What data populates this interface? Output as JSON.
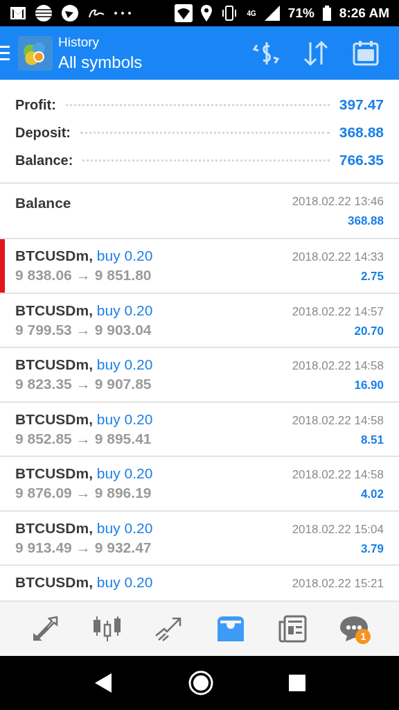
{
  "status_bar": {
    "network": "4G",
    "battery": "71%",
    "time": "8:26 AM"
  },
  "app_bar": {
    "title": "History",
    "subtitle": "All symbols"
  },
  "summary": [
    {
      "label": "Profit:",
      "value": "397.47"
    },
    {
      "label": "Deposit:",
      "value": "368.88"
    },
    {
      "label": "Balance:",
      "value": "766.35"
    }
  ],
  "entries": [
    {
      "kind": "balance",
      "selected": false,
      "title": "Balance",
      "time": "2018.02.22 13:46",
      "amount": "368.88"
    },
    {
      "kind": "trade",
      "selected": true,
      "symbol": "BTCUSDm,",
      "side": "buy 0.20",
      "open": "9 838.06",
      "arrow": "→",
      "close": "9 851.80",
      "time": "2018.02.22 14:33",
      "amount": "2.75"
    },
    {
      "kind": "trade",
      "selected": false,
      "symbol": "BTCUSDm,",
      "side": "buy 0.20",
      "open": "9 799.53",
      "arrow": "→",
      "close": "9 903.04",
      "time": "2018.02.22 14:57",
      "amount": "20.70"
    },
    {
      "kind": "trade",
      "selected": false,
      "symbol": "BTCUSDm,",
      "side": "buy 0.20",
      "open": "9 823.35",
      "arrow": "→",
      "close": "9 907.85",
      "time": "2018.02.22 14:58",
      "amount": "16.90"
    },
    {
      "kind": "trade",
      "selected": false,
      "symbol": "BTCUSDm,",
      "side": "buy 0.20",
      "open": "9 852.85",
      "arrow": "→",
      "close": "9 895.41",
      "time": "2018.02.22 14:58",
      "amount": "8.51"
    },
    {
      "kind": "trade",
      "selected": false,
      "symbol": "BTCUSDm,",
      "side": "buy 0.20",
      "open": "9 876.09",
      "arrow": "→",
      "close": "9 896.19",
      "time": "2018.02.22 14:58",
      "amount": "4.02"
    },
    {
      "kind": "trade",
      "selected": false,
      "symbol": "BTCUSDm,",
      "side": "buy 0.20",
      "open": "9 913.49",
      "arrow": "→",
      "close": "9 932.47",
      "time": "2018.02.22 15:04",
      "amount": "3.79"
    },
    {
      "kind": "trade",
      "selected": false,
      "symbol": "BTCUSDm,",
      "side": "buy 0.20",
      "time": "2018.02.22 15:21"
    }
  ],
  "bottom_nav": [
    {
      "kind": "quotes",
      "selected": false
    },
    {
      "kind": "chart",
      "selected": false
    },
    {
      "kind": "trade",
      "selected": false
    },
    {
      "kind": "history",
      "selected": true
    },
    {
      "kind": "news",
      "selected": false
    },
    {
      "kind": "chat",
      "selected": false,
      "badge": "1"
    }
  ]
}
